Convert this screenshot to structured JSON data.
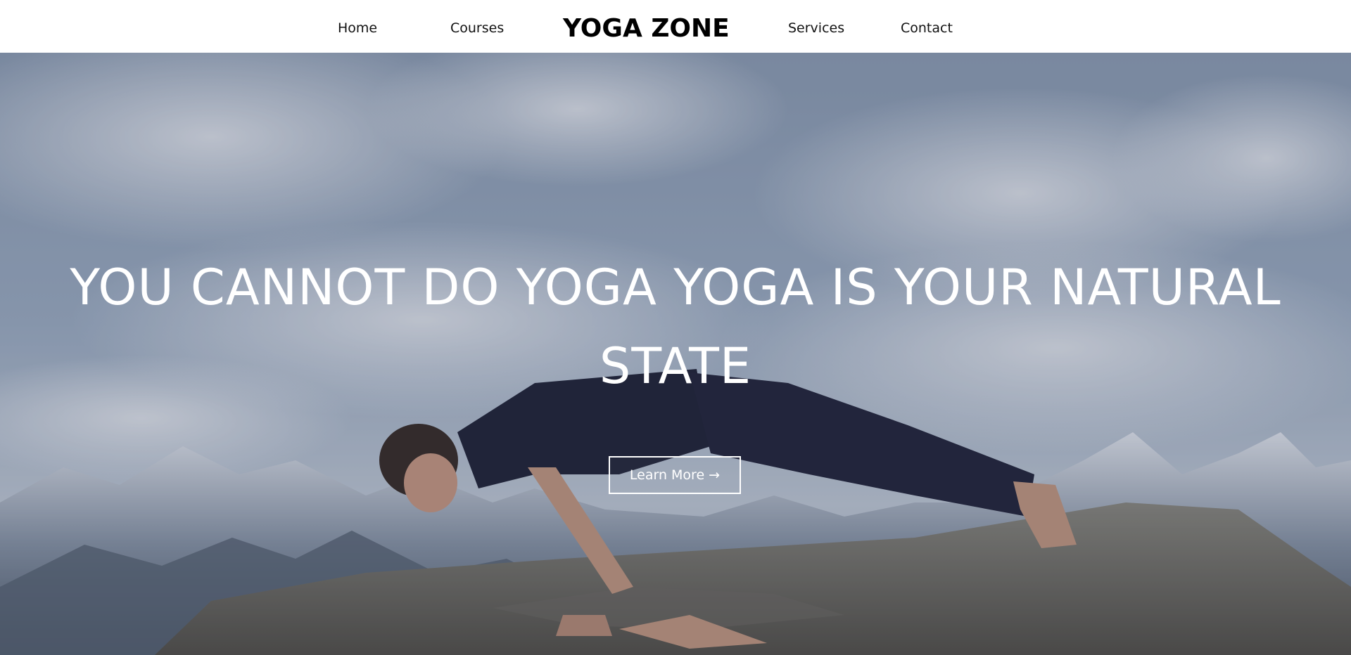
{
  "nav": {
    "home": "Home",
    "courses": "Courses",
    "brand": "YOGA ZONE",
    "services": "Services",
    "contact": "Contact"
  },
  "hero": {
    "headline": "YOU CANNOT DO YOGA YOGA IS YOUR NATURAL STATE",
    "cta_label": "Learn More →"
  },
  "colors": {
    "nav_background": "#ffffff",
    "nav_text": "#111111",
    "hero_text": "#ffffff",
    "sky": "#7d91ad"
  }
}
